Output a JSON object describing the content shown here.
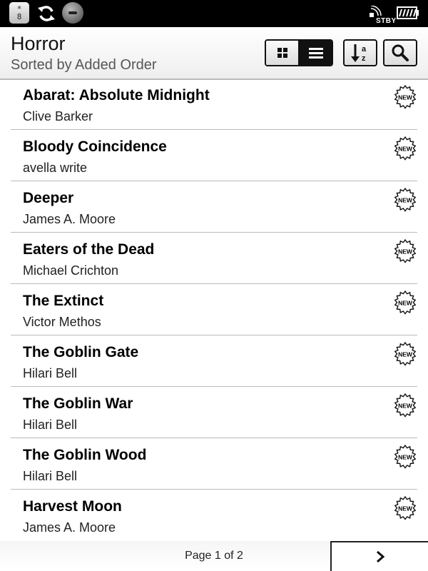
{
  "status_bar": {
    "keyboard_icon_top": "*",
    "keyboard_icon_bottom": "8",
    "standby_label": "STBY",
    "icons": [
      "keyboard-icon",
      "sync-icon",
      "wireless-off-icon",
      "standby-signal-icon",
      "battery-icon"
    ]
  },
  "header": {
    "title": "Horror",
    "subtitle": "Sorted by Added Order",
    "grid_view_icon": "grid-icon",
    "list_view_icon": "list-icon",
    "sort_icon": "sort-az-icon",
    "search_icon": "search-icon",
    "active_view": "list"
  },
  "books": [
    {
      "title": "Abarat: Absolute Midnight",
      "author": "Clive Barker",
      "badge": "NEW"
    },
    {
      "title": "Bloody Coincidence",
      "author": "avella write",
      "badge": "NEW"
    },
    {
      "title": "Deeper",
      "author": "James A. Moore",
      "badge": "NEW"
    },
    {
      "title": "Eaters of the Dead",
      "author": "Michael Crichton",
      "badge": "NEW"
    },
    {
      "title": "The Extinct",
      "author": "Victor Methos",
      "badge": "NEW"
    },
    {
      "title": "The Goblin Gate",
      "author": "Hilari Bell",
      "badge": "NEW"
    },
    {
      "title": "The Goblin War",
      "author": "Hilari Bell",
      "badge": "NEW"
    },
    {
      "title": "The Goblin Wood",
      "author": "Hilari Bell",
      "badge": "NEW"
    },
    {
      "title": "Harvest Moon",
      "author": "James A. Moore",
      "badge": "NEW"
    }
  ],
  "footer": {
    "page_indicator": "Page 1 of 2",
    "next_icon": "chevron-right-icon"
  }
}
